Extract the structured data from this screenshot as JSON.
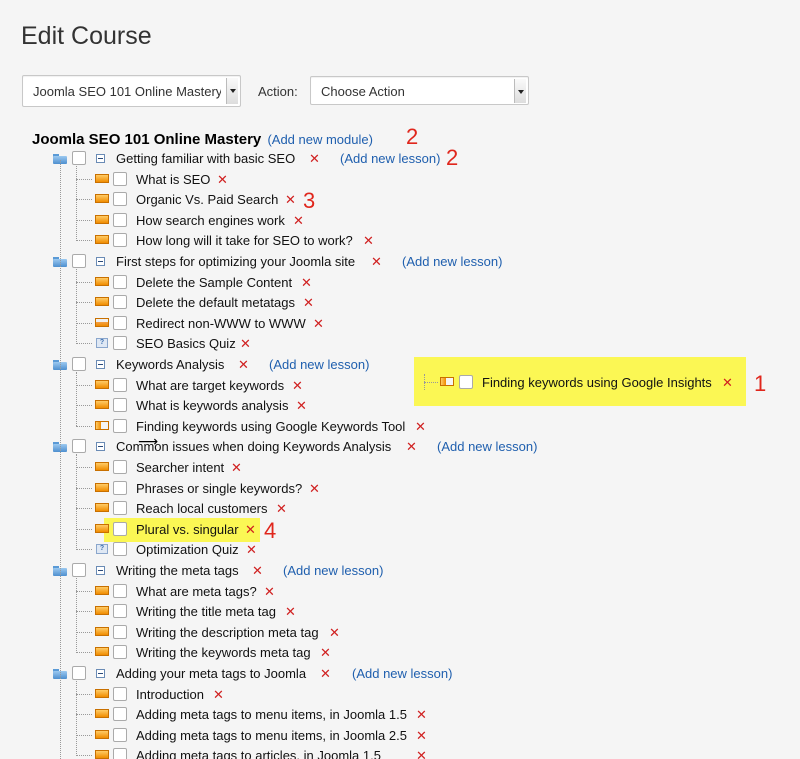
{
  "page": {
    "title": "Edit Course"
  },
  "toolbar": {
    "course_select_value": "Joomla SEO 101 Online Mastery",
    "action_label": "Action:",
    "action_select_value": "Choose Action"
  },
  "course": {
    "title": "Joomla SEO 101 Online Mastery",
    "add_module": "(Add new module)",
    "add_lesson": "(Add new lesson)",
    "delete_glyph": "✕"
  },
  "modules": [
    {
      "title": "Getting familiar with basic SEO",
      "lessons": [
        "What is SEO",
        "Organic Vs. Paid Search",
        "How search engines work",
        "How long will it take for SEO to work?"
      ]
    },
    {
      "title": "First steps for optimizing your Joomla site",
      "lessons": [
        "Delete the Sample Content",
        "Delete the default metatags",
        "Redirect non-WWW to WWW",
        "SEO Basics Quiz"
      ]
    },
    {
      "title": "Keywords Analysis",
      "lessons": [
        "What are target keywords",
        "What is keywords analysis",
        "Finding keywords using Google Keywords Tool"
      ]
    },
    {
      "title": "Common issues when doing Keywords Analysis",
      "lessons": [
        "Searcher intent",
        "Phrases or single keywords?",
        "Reach local customers",
        "Plural vs. singular",
        "Optimization Quiz"
      ]
    },
    {
      "title": "Writing the meta tags",
      "lessons": [
        "What are meta tags?",
        "Writing the title meta tag",
        "Writing the description meta tag",
        "Writing the keywords meta tag"
      ]
    },
    {
      "title": "Adding your meta tags to Joomla",
      "lessons": [
        "Introduction",
        "Adding meta tags to menu items, in Joomla 1.5",
        "Adding meta tags to menu items, in Joomla 2.5",
        "Adding meta tags to articles, in Joomla 1.5"
      ]
    }
  ],
  "dragged_item": {
    "title": "Finding keywords using Google Insights"
  },
  "annotations": {
    "one": "1",
    "two": "2",
    "three": "3",
    "four": "4"
  }
}
